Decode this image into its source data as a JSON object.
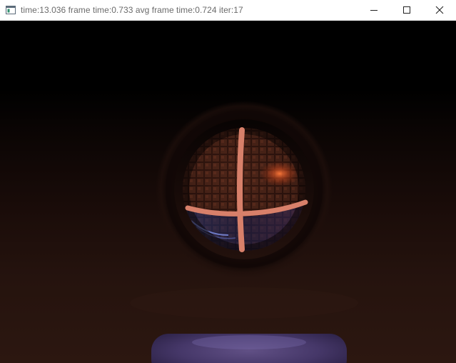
{
  "window": {
    "title": "time:13.036 frame time:0.733 avg frame time:0.724 iter:17"
  },
  "caption_buttons": {
    "minimize_icon": "minimize-icon",
    "maximize_icon": "maximize-icon",
    "close_icon": "close-icon"
  },
  "scene": {
    "description_icon": "raytraced-sphere",
    "background_top": "#000000",
    "background_bottom": "#2c1710",
    "sphere_stripe_color": "#d8806a",
    "floor_platform_color": "#5a4a8a"
  }
}
